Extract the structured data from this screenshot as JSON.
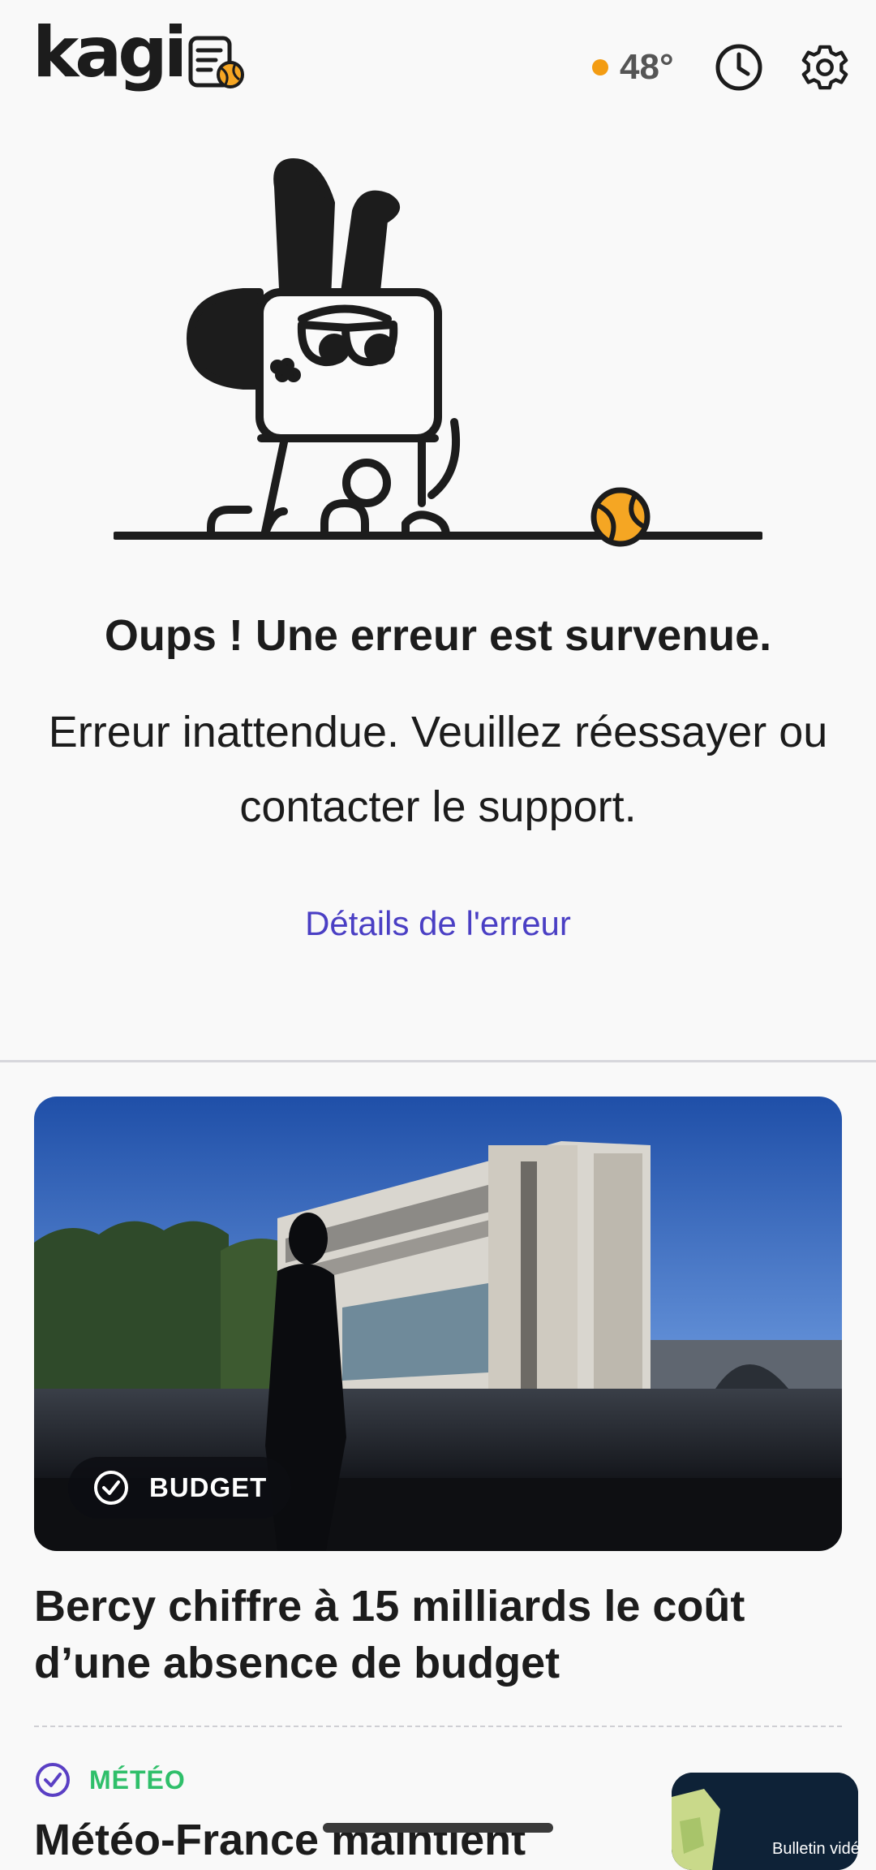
{
  "header": {
    "logo_text": "kagi",
    "weather": {
      "temperature": "48°",
      "dot_color": "#f39c12"
    },
    "icons": [
      "history-clock-icon",
      "settings-gear-icon"
    ]
  },
  "error": {
    "title": "Oups ! Une erreur est survenue.",
    "message": "Erreur inattendue. Veuillez réessayer ou contacter le support.",
    "details_link": "Détails de l'erreur"
  },
  "stories": [
    {
      "category": "BUDGET",
      "title": "Bercy chiffre à 15 milliards le coût d’une absence de budget"
    },
    {
      "category": "MÉTÉO",
      "title": "Météo-France maintient",
      "thumbnail_caption": "Bulletin vidéo"
    }
  ],
  "colors": {
    "accent_link": "#4a3fc4",
    "meteo_category": "#2fbf6a",
    "tennis_ball": "#f5a623"
  }
}
